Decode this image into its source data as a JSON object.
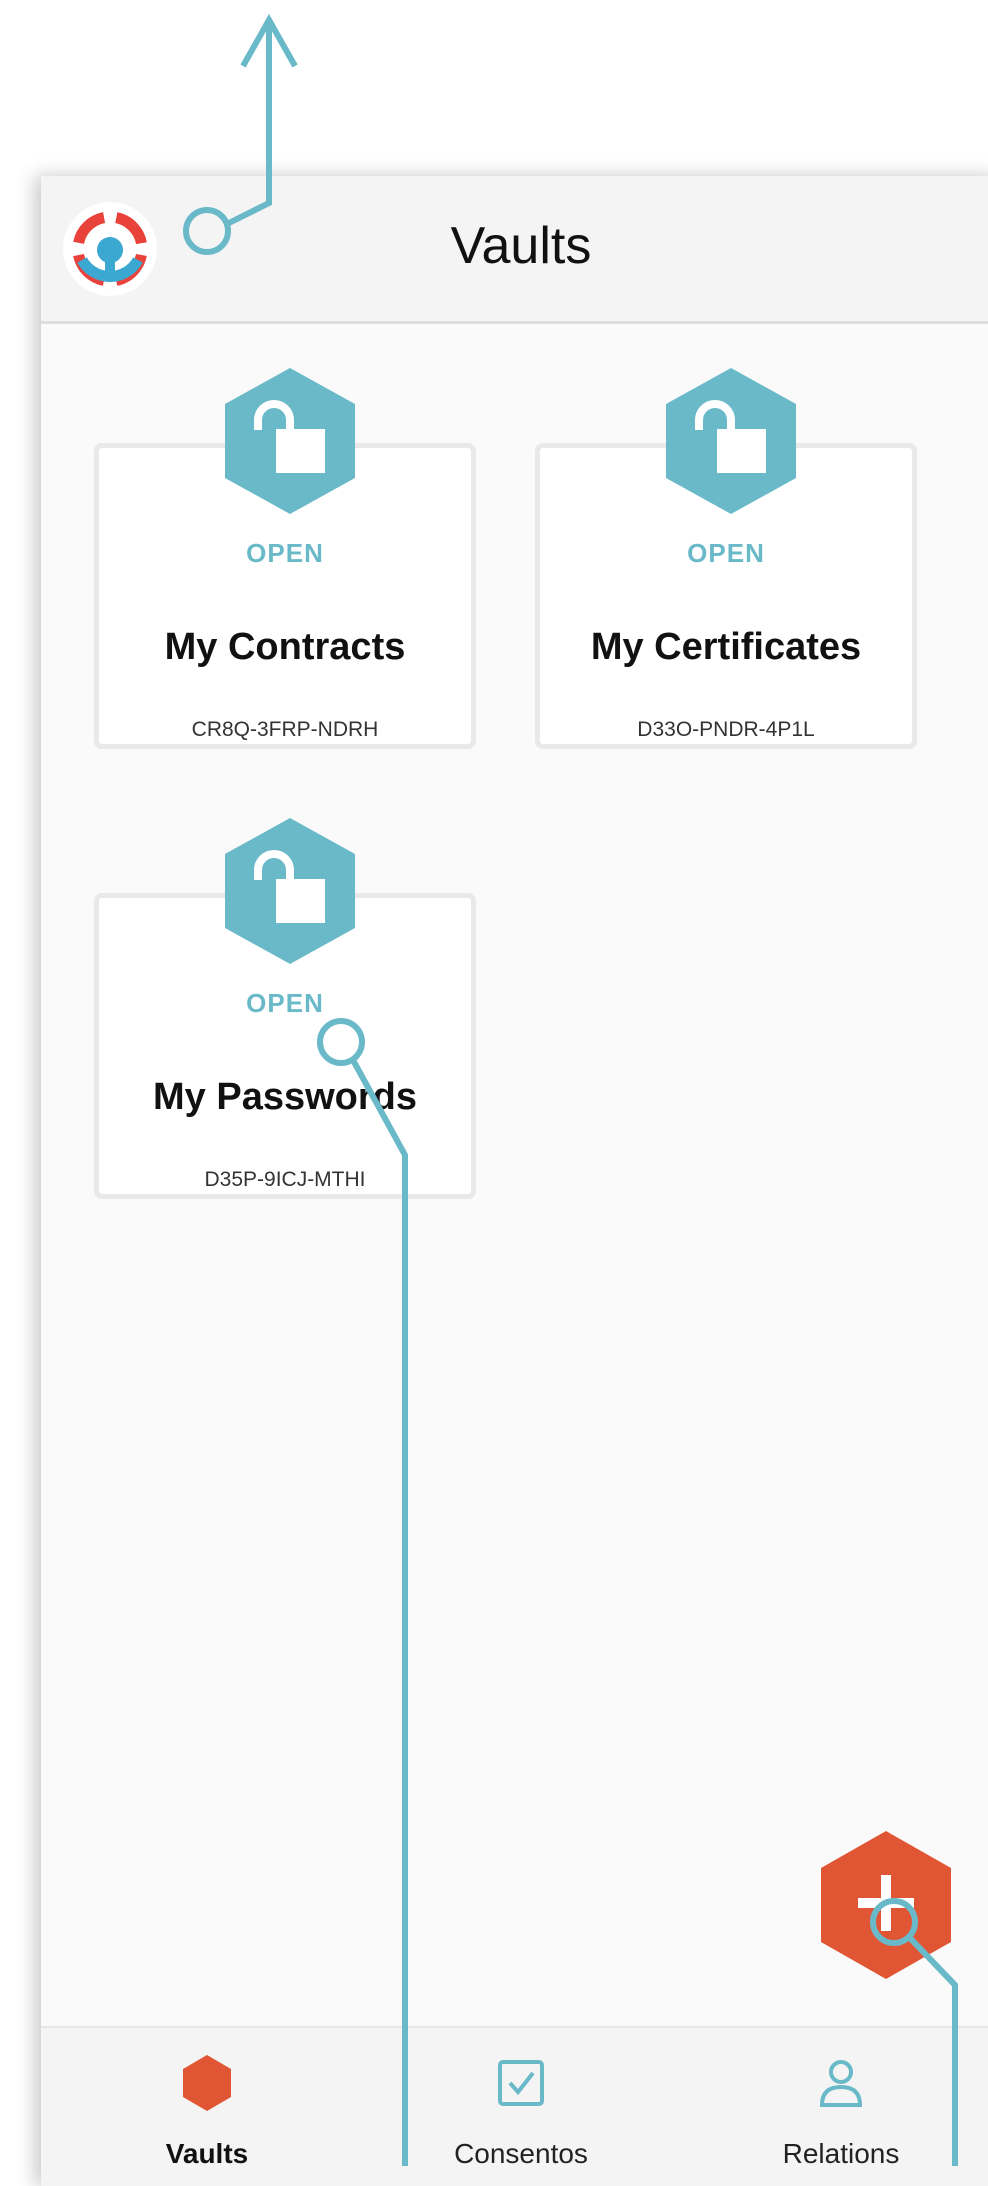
{
  "appbar": {
    "title": "Vaults",
    "logo_icon": "lifebuoy-logo-icon"
  },
  "vaults": [
    {
      "status": "OPEN",
      "name": "My Contracts",
      "code": "CR8Q-3FRP-NDRH",
      "icon": "unlocked-padlock-icon"
    },
    {
      "status": "OPEN",
      "name": "My Certificates",
      "code": "D33O-PNDR-4P1L",
      "icon": "unlocked-padlock-icon"
    },
    {
      "status": "OPEN",
      "name": "My Passwords",
      "code": "D35P-9ICJ-MTHI",
      "icon": "unlocked-padlock-icon"
    }
  ],
  "fab": {
    "icon": "plus-icon"
  },
  "bottom_nav": [
    {
      "label": "Vaults",
      "icon": "hexagon-icon",
      "active": true
    },
    {
      "label": "Consentos",
      "icon": "checkbox-icon",
      "active": false
    },
    {
      "label": "Relations",
      "icon": "person-icon",
      "active": false
    }
  ],
  "colors": {
    "accent_teal": "#69b9c9",
    "accent_orange": "#e05534",
    "logo_red": "#e8423b",
    "logo_blue": "#3aa8d0",
    "background": "#fafafa",
    "bar": "#f4f4f4"
  }
}
